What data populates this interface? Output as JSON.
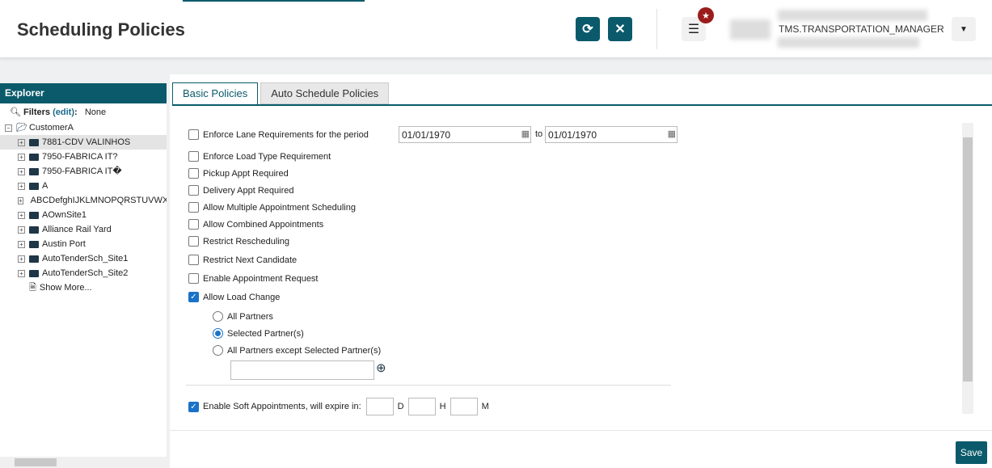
{
  "header": {
    "title": "Scheduling Policies",
    "user_role": "TMS.TRANSPORTATION_MANAGER",
    "refresh_icon": "refresh-icon",
    "close_icon": "close-icon",
    "menu_icon": "menu-icon",
    "star_icon": "star-icon",
    "dropdown_icon": "chevron-down-icon"
  },
  "explorer": {
    "title": "Explorer",
    "filters_label": "Filters",
    "filters_edit": "(edit)",
    "filters_colon": ":",
    "filters_value": "None",
    "root": "CustomerA",
    "items": [
      "7881-CDV VALINHOS",
      "7950-FABRICA IT?",
      "7950-FABRICA IT�",
      "A",
      "ABCDefghIJKLMNOPQRSTUVWXYZ",
      "AOwnSite1",
      "Alliance Rail Yard",
      "Austin Port",
      "AutoTenderSch_Site1",
      "AutoTenderSch_Site2"
    ],
    "show_more": "Show More..."
  },
  "tabs": [
    "Basic Policies",
    "Auto Schedule Policies"
  ],
  "policies": {
    "lane": {
      "label": "Enforce Lane Requirements for the period",
      "checked": false,
      "from": "01/01/1970",
      "to_label": "to",
      "to": "01/01/1970"
    },
    "options": [
      {
        "label": "Enforce Load Type Requirement",
        "checked": false
      },
      {
        "label": "Pickup Appt Required",
        "checked": false
      },
      {
        "label": "Delivery Appt Required",
        "checked": false
      },
      {
        "label": "Allow Multiple Appointment Scheduling",
        "checked": false
      },
      {
        "label": "Allow Combined Appointments",
        "checked": false
      },
      {
        "label": "Restrict Rescheduling",
        "checked": false
      },
      {
        "label": "Restrict Next Candidate",
        "checked": false
      },
      {
        "label": "Enable Appointment Request",
        "checked": false
      },
      {
        "label": "Allow Load Change",
        "checked": true
      }
    ],
    "partners": [
      {
        "label": "All Partners",
        "selected": false
      },
      {
        "label": "Selected Partner(s)",
        "selected": true
      },
      {
        "label": "All Partners except Selected Partner(s)",
        "selected": false
      }
    ],
    "partner_search": "",
    "soft": {
      "label": "Enable Soft Appointments, will expire in:",
      "checked": true,
      "d": "",
      "d_label": "D",
      "h": "",
      "h_label": "H",
      "m": "",
      "m_label": "M"
    }
  },
  "save_label": "Save"
}
